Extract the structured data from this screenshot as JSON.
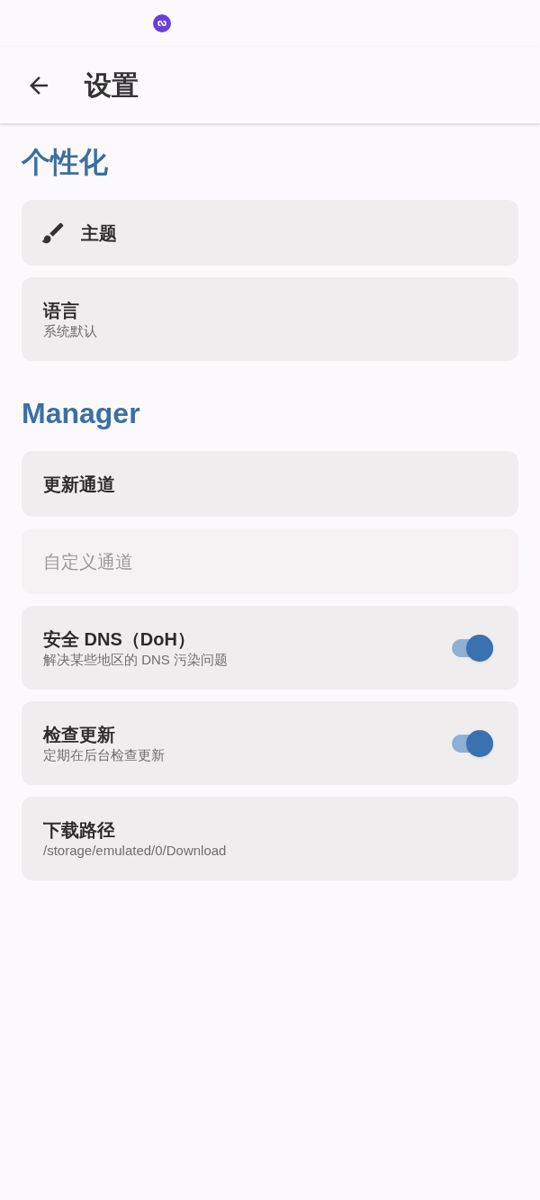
{
  "app_bar": {
    "title": "设置"
  },
  "sections": [
    {
      "title": "个性化",
      "items": [
        {
          "kind": "icon",
          "title": "主题"
        },
        {
          "kind": "plain",
          "title": "语言",
          "subtitle": "系统默认"
        }
      ]
    },
    {
      "title": "Manager",
      "items": [
        {
          "kind": "plain",
          "title": "更新通道"
        },
        {
          "kind": "plain",
          "title": "自定义通道",
          "disabled": true
        },
        {
          "kind": "switch",
          "title": "安全 DNS（DoH）",
          "subtitle": "解决某些地区的 DNS 污染问题",
          "on": true
        },
        {
          "kind": "switch",
          "title": "检查更新",
          "subtitle": "定期在后台检查更新",
          "on": true
        },
        {
          "kind": "plain",
          "title": "下载路径",
          "subtitle": "/storage/emulated/0/Download"
        }
      ]
    }
  ]
}
